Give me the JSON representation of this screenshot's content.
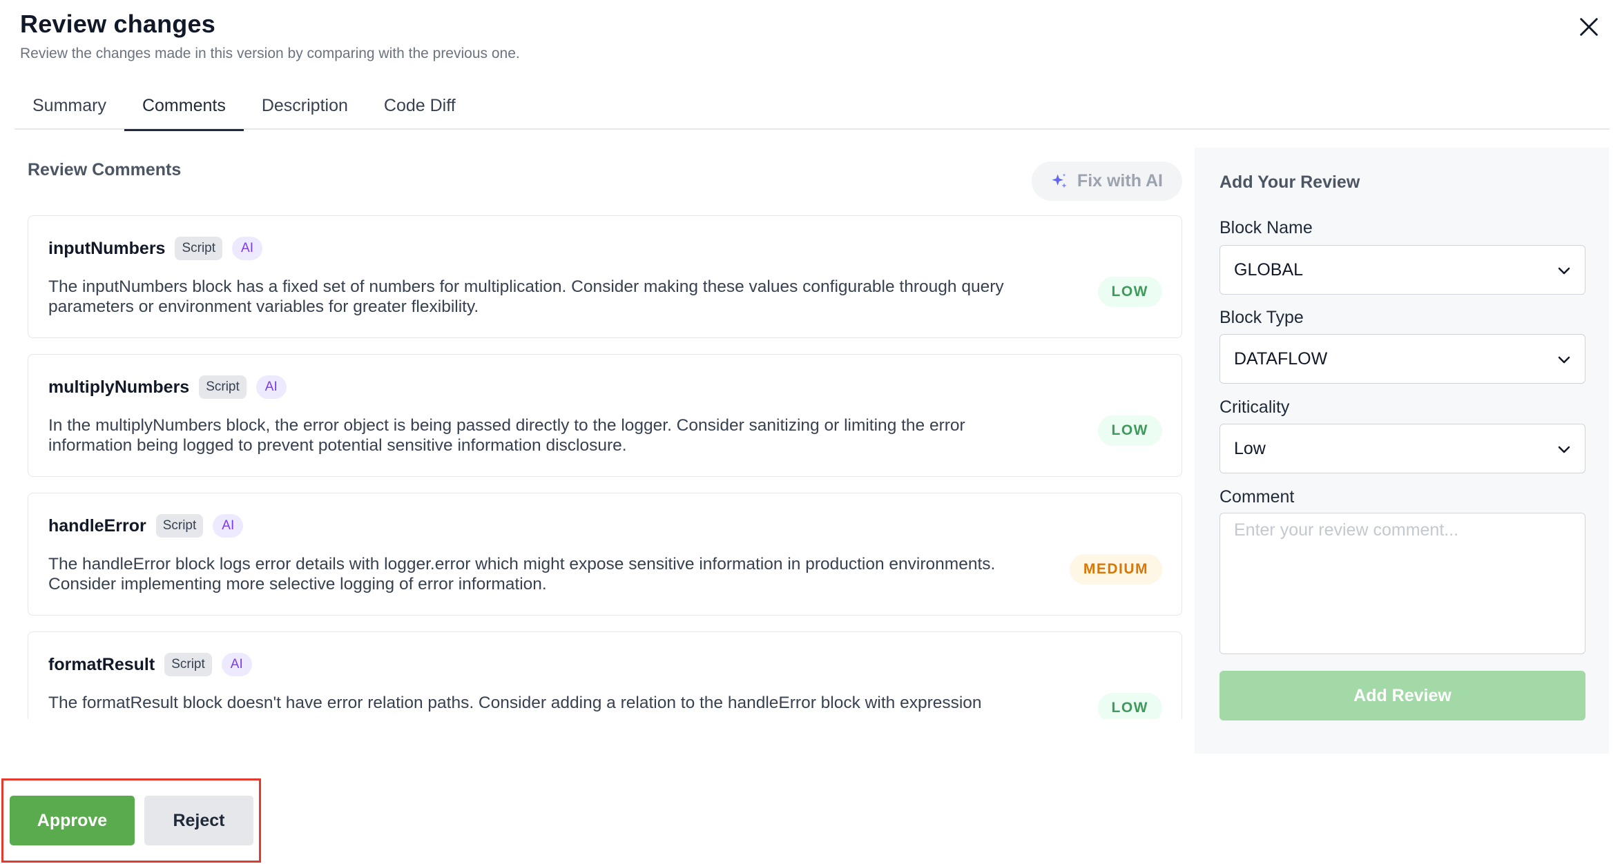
{
  "header": {
    "title": "Review changes",
    "subtitle": "Review the changes made in this version by comparing with the previous one."
  },
  "tabs": [
    {
      "label": "Summary",
      "active": false
    },
    {
      "label": "Comments",
      "active": true
    },
    {
      "label": "Description",
      "active": false
    },
    {
      "label": "Code Diff",
      "active": false
    }
  ],
  "comments_panel": {
    "title": "Review Comments",
    "fix_ai_label": "Fix with AI",
    "items": [
      {
        "block": "inputNumbers",
        "type_chip": "Script",
        "source_chip": "AI",
        "text": "The inputNumbers block has a fixed set of numbers for multiplication. Consider making these values configurable through query parameters or environment variables for greater flexibility.",
        "severity": "LOW"
      },
      {
        "block": "multiplyNumbers",
        "type_chip": "Script",
        "source_chip": "AI",
        "text": "In the multiplyNumbers block, the error object is being passed directly to the logger. Consider sanitizing or limiting the error information being logged to prevent potential sensitive information disclosure.",
        "severity": "LOW"
      },
      {
        "block": "handleError",
        "type_chip": "Script",
        "source_chip": "AI",
        "text": "The handleError block logs error details with logger.error which might expose sensitive information in production environments. Consider implementing more selective logging of error information.",
        "severity": "MEDIUM"
      },
      {
        "block": "formatResult",
        "type_chip": "Script",
        "source_chip": "AI",
        "text": "The formatResult block doesn't have error relation paths. Consider adding a relation to the handleError block with expression",
        "severity": "LOW"
      }
    ]
  },
  "review_form": {
    "title": "Add Your Review",
    "block_name_label": "Block Name",
    "block_name_value": "GLOBAL",
    "block_type_label": "Block Type",
    "block_type_value": "DATAFLOW",
    "criticality_label": "Criticality",
    "criticality_value": "Low",
    "comment_label": "Comment",
    "comment_placeholder": "Enter your review comment...",
    "submit_label": "Add Review"
  },
  "actions": {
    "approve_label": "Approve",
    "reject_label": "Reject"
  },
  "colors": {
    "approve": "#5aaa4e",
    "add_review_disabled": "#a3d8a7",
    "highlight_frame": "#e23b2e",
    "severity_low": "#3f9a5c",
    "severity_medium": "#d97706",
    "ai_chip": "#7c3aed"
  }
}
